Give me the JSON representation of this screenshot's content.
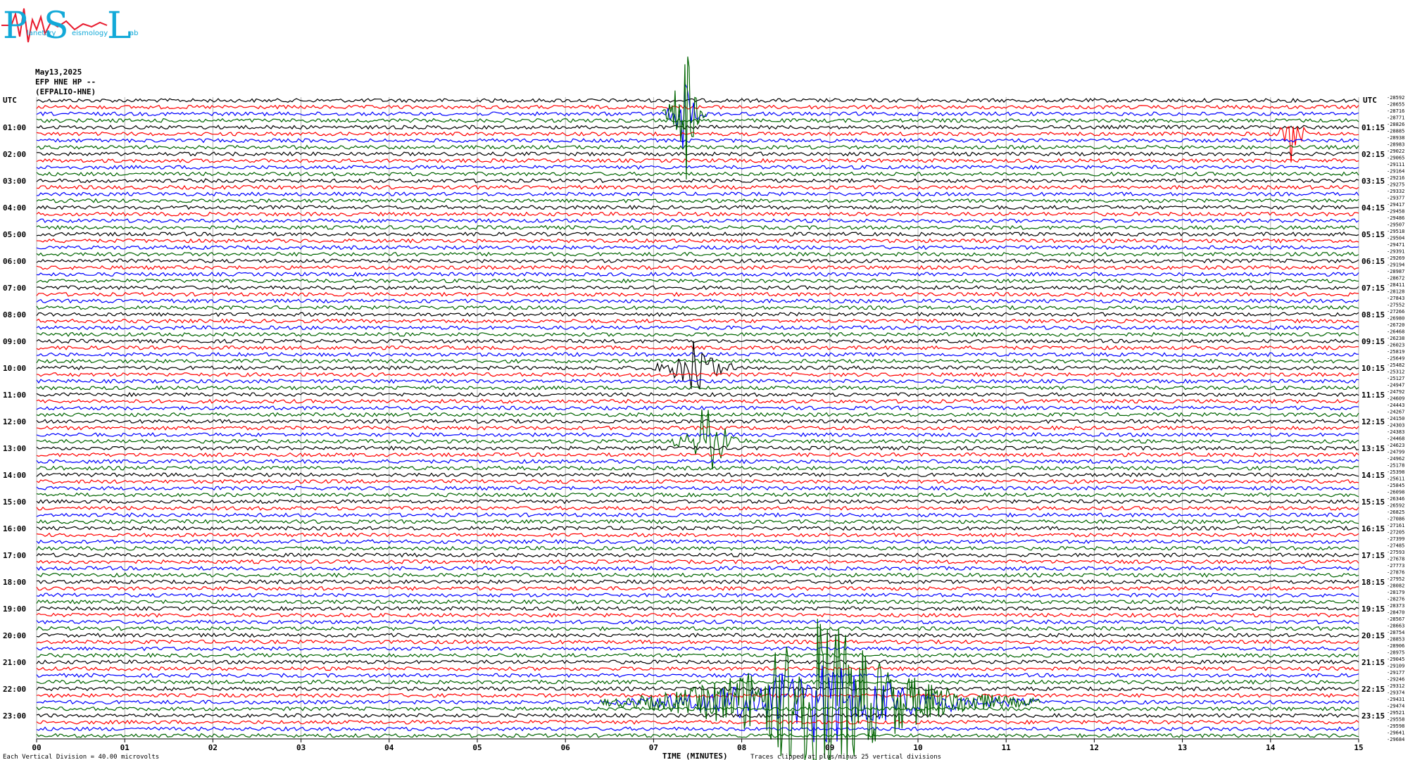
{
  "logo": {
    "letters": [
      "P",
      "S",
      "L"
    ],
    "subtext": [
      "lanetary",
      "eismology",
      "ab"
    ],
    "color": "#12a9d8",
    "wave_color": "#e8192c"
  },
  "header": {
    "date": "May13,2025",
    "station": "EFP HNE HP --",
    "channel": "(EFPALIO-HNE)"
  },
  "chart_data": {
    "type": "line",
    "title": "",
    "xlabel": "TIME (MINUTES)",
    "x_ticks": [
      "00",
      "01",
      "02",
      "03",
      "04",
      "05",
      "06",
      "07",
      "08",
      "09",
      "10",
      "11",
      "12",
      "13",
      "14",
      "15"
    ],
    "xlim": [
      0,
      15
    ],
    "left_axis_title": "UTC",
    "right_axis_title": "UTC",
    "left_hour_labels": [
      "01:00",
      "02:00",
      "03:00",
      "04:00",
      "05:00",
      "06:00",
      "07:00",
      "08:00",
      "09:00",
      "10:00",
      "11:00",
      "12:00",
      "13:00",
      "14:00",
      "15:00",
      "16:00",
      "17:00",
      "18:00",
      "19:00",
      "20:00",
      "21:00",
      "22:00",
      "23:00"
    ],
    "right_hour_labels": [
      "01:15",
      "02:15",
      "03:15",
      "04:15",
      "05:15",
      "06:15",
      "07:15",
      "08:15",
      "09:15",
      "10:15",
      "11:15",
      "12:15",
      "13:15",
      "14:15",
      "15:15",
      "16:15",
      "17:15",
      "18:15",
      "19:15",
      "20:15",
      "21:15",
      "22:15",
      "23:15"
    ],
    "trace_count": 96,
    "trace_minutes": 15,
    "trace_colors": [
      "#000000",
      "#ff0000",
      "#0000ff",
      "#006400"
    ],
    "trace_offsets": [
      -28592,
      -28655,
      -28716,
      -28771,
      -28826,
      -28885,
      -28938,
      -28983,
      -29022,
      -29065,
      -29111,
      -29164,
      -29216,
      -29275,
      -29332,
      -29377,
      -29417,
      -29458,
      -29486,
      -29507,
      -29518,
      -29504,
      -29471,
      -29391,
      -29269,
      -29194,
      -28987,
      -28672,
      -28411,
      -28128,
      -27843,
      -27552,
      -27266,
      -26980,
      -26720,
      -26468,
      -26238,
      -26023,
      -25819,
      -25649,
      -25482,
      -25312,
      -25127,
      -24947,
      -24792,
      -24609,
      -24443,
      -24267,
      -24150,
      -24303,
      -24383,
      -24468,
      -24623,
      -24799,
      -24962,
      -25178,
      -25398,
      -25611,
      -25845,
      -26098,
      -26346,
      -26592,
      -26825,
      -27086,
      -27161,
      -27205,
      -27399,
      -27485,
      -27593,
      -27678,
      -27773,
      -27876,
      -27952,
      -28082,
      -28179,
      -28276,
      -28373,
      -28470,
      -28567,
      -28663,
      -28754,
      -28853,
      -28906,
      -28975,
      -29045,
      -29109,
      -29177,
      -29246,
      -29312,
      -29374,
      -29431,
      -29474,
      -29521,
      -29558,
      -29598,
      -29641
    ],
    "last_offset": "-29684",
    "scale_note": "Each Vertical Division =   40.00 microvolts",
    "clip_note": "Traces clipped at plus/minus 25 vertical divisions",
    "events": [
      {
        "trace": 2,
        "minute": 7.35,
        "amp": 1.0,
        "dur": 0.25,
        "color": "#006400",
        "note": "large clipped event"
      },
      {
        "trace": 5,
        "minute": 14.25,
        "amp": 0.9,
        "dur": 0.2
      },
      {
        "trace": 40,
        "minute": 7.45,
        "amp": 0.9,
        "dur": 0.5
      },
      {
        "trace": 51,
        "minute": 7.6,
        "amp": 0.9,
        "dur": 0.5
      },
      {
        "trace": 90,
        "minute": 8.9,
        "amp": 1.0,
        "dur": 2.5,
        "color": "#006400",
        "note": "large clipped event"
      }
    ]
  }
}
